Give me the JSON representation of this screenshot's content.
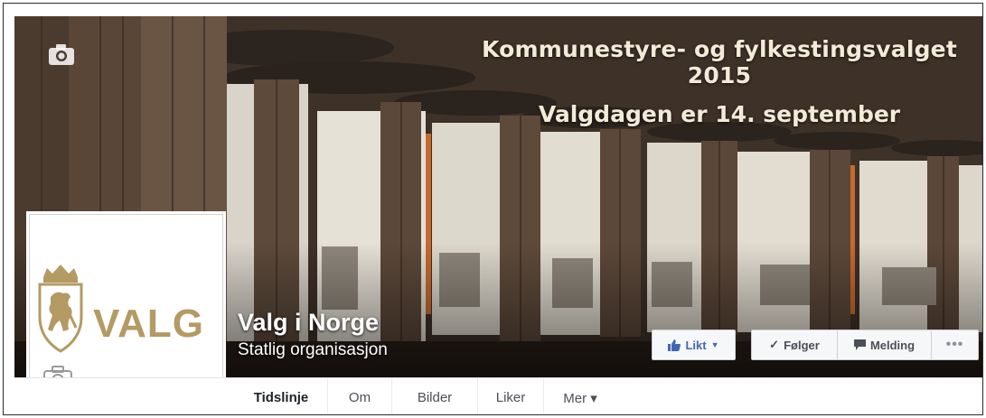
{
  "cover": {
    "headline_line1": "Kommunestyre- og fylkestingsvalget 2015",
    "headline_line2": "Valgdagen er 14. september",
    "camera_icon": "camera-icon"
  },
  "page": {
    "name": "Valg i Norge",
    "category": "Statlig organisasjon"
  },
  "profile": {
    "wordmark": "VALG",
    "logo_icon": "coat-of-arms-lion-icon",
    "camera_icon": "camera-icon"
  },
  "actions": {
    "like_label": "Likt",
    "follow_label": "Følger",
    "message_label": "Melding",
    "more_label": "•••"
  },
  "tabs": [
    {
      "label": "Tidslinje",
      "active": true
    },
    {
      "label": "Om",
      "active": false
    },
    {
      "label": "Bilder",
      "active": false
    },
    {
      "label": "Liker",
      "active": false
    },
    {
      "label": "Mer ▾",
      "active": false
    }
  ],
  "colors": {
    "brand_blue": "#4267b2",
    "valg_gold": "#b49a63",
    "headline_text": "#f3ead7"
  }
}
